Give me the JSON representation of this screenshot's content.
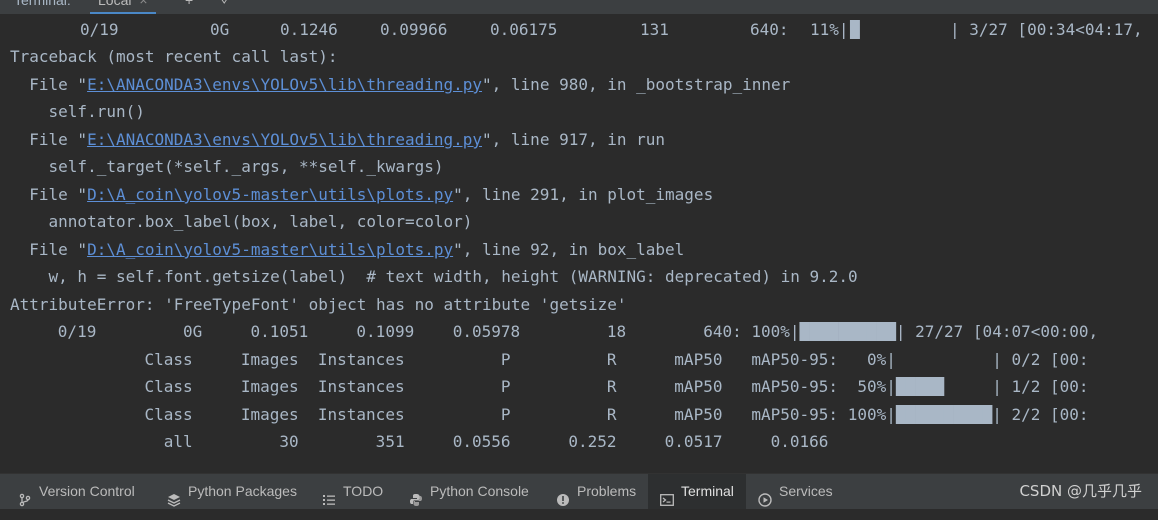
{
  "tabs": {
    "title": "Terminal:",
    "active_tab": "Local",
    "close_glyph": "×",
    "add_glyph": "+",
    "menu_glyph": "⌄"
  },
  "terminal": {
    "progress_line_1": {
      "epoch": "0/19",
      "gpu_mem": "0G",
      "box_loss": "0.1246",
      "obj_loss": "0.09966",
      "cls_loss": "0.06175",
      "instances": "131",
      "size": "640:",
      "percent": "11%|",
      "bar": "█         ",
      "tail": "| 3/27 [00:34<04:17,",
      "progress": 0.11
    },
    "traceback_header": "Traceback (most recent call last):",
    "frames": [
      {
        "prefix": "  File \"",
        "path": "E:\\ANACONDA3\\envs\\YOLOv5\\lib\\threading.py",
        "suffix": "\", line 980, in _bootstrap_inner",
        "code": "    self.run()"
      },
      {
        "prefix": "  File \"",
        "path": "E:\\ANACONDA3\\envs\\YOLOv5\\lib\\threading.py",
        "suffix": "\", line 917, in run",
        "code": "    self._target(*self._args, **self._kwargs)"
      },
      {
        "prefix": "  File \"",
        "path": "D:\\A_coin\\yolov5-master\\utils\\plots.py",
        "suffix": "\", line 291, in plot_images",
        "code": "    annotator.box_label(box, label, color=color)"
      },
      {
        "prefix": "  File \"",
        "path": "D:\\A_coin\\yolov5-master\\utils\\plots.py",
        "suffix": "\", line 92, in box_label",
        "code": "    w, h = self.font.getsize(label)  # text width, height (WARNING: deprecated) in 9.2.0"
      }
    ],
    "error": "AttributeError: 'FreeTypeFont' object has no attribute 'getsize'",
    "progress_line_2": {
      "text": "      0/19         0G     0.1051     0.1099    0.05978         18        640: 100%|",
      "bar": "██████████",
      "tail": "| 27/27 [04:07<00:00,",
      "progress": 1.0
    },
    "val_lines": [
      {
        "text": "               Class     Images  Instances          P          R      mAP50   mAP50-95:   0%|",
        "bar": "          ",
        "tail": "| 0/2 [00:",
        "progress": 0.0
      },
      {
        "text": "               Class     Images  Instances          P          R      mAP50   mAP50-95:  50%|",
        "bar": "█████     ",
        "tail": "| 1/2 [00:",
        "progress": 0.5
      },
      {
        "text": "               Class     Images  Instances          P          R      mAP50   mAP50-95: 100%|",
        "bar": "██████████",
        "tail": "| 2/2 [00:",
        "progress": 1.0
      }
    ],
    "results_line": "                 all         30        351     0.0556      0.252     0.0517     0.0166"
  },
  "statusbar": {
    "items": [
      {
        "label": "Version Control",
        "icon": "branch-icon"
      },
      {
        "label": "Python Packages",
        "icon": "layers-icon"
      },
      {
        "label": "TODO",
        "icon": "list-icon"
      },
      {
        "label": "Python Console",
        "icon": "python-icon"
      },
      {
        "label": "Problems",
        "icon": "info-icon"
      },
      {
        "label": "Terminal",
        "icon": "terminal-icon"
      },
      {
        "label": "Services",
        "icon": "play-circle-icon"
      }
    ],
    "watermark": "CSDN @几乎几乎"
  },
  "colors": {
    "background": "#2b2b2b",
    "text": "#a9b7c6",
    "link": "#5d8fd6",
    "toolbar": "#3c3f41"
  }
}
